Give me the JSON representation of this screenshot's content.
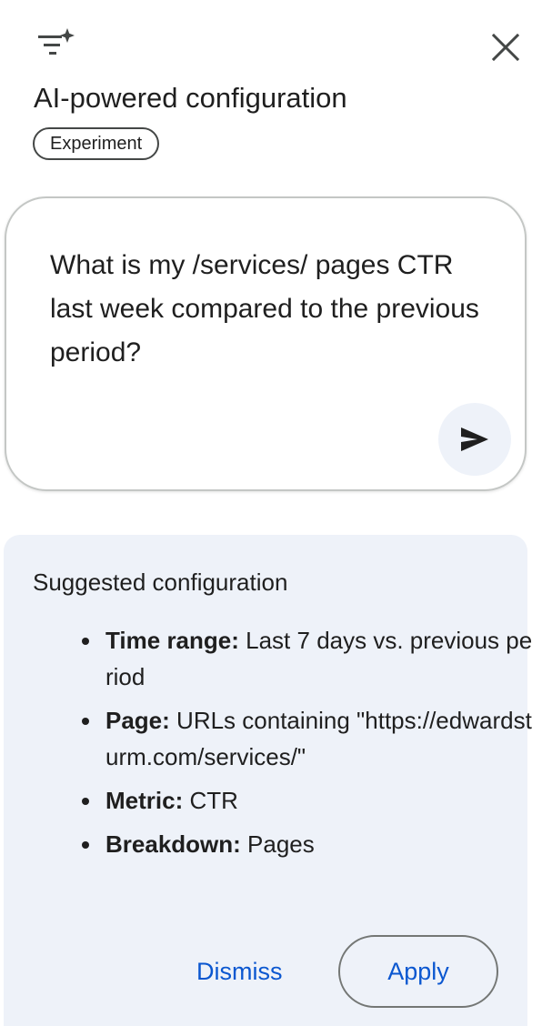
{
  "header": {
    "title": "AI-powered configuration",
    "badge": "Experiment",
    "icon": "filter-sparkle-icon",
    "close_icon": "close-icon"
  },
  "prompt": {
    "text": "What is my /services/ pages CTR last week compared to the previous period?",
    "send_icon": "send-icon"
  },
  "suggestion": {
    "title": "Suggested configuration",
    "items": [
      {
        "key": "Time range:",
        "value": "Last 7 days vs. previous period"
      },
      {
        "key": "Page:",
        "value": "URLs containing \"https://edwardsturm.com/services/\""
      },
      {
        "key": "Metric:",
        "value": "CTR"
      },
      {
        "key": "Breakdown:",
        "value": "Pages"
      }
    ],
    "dismiss_label": "Dismiss",
    "apply_label": "Apply"
  },
  "colors": {
    "accent": "#0b57d0",
    "card_bg": "#eef2f9",
    "text": "#1f1f1f"
  }
}
